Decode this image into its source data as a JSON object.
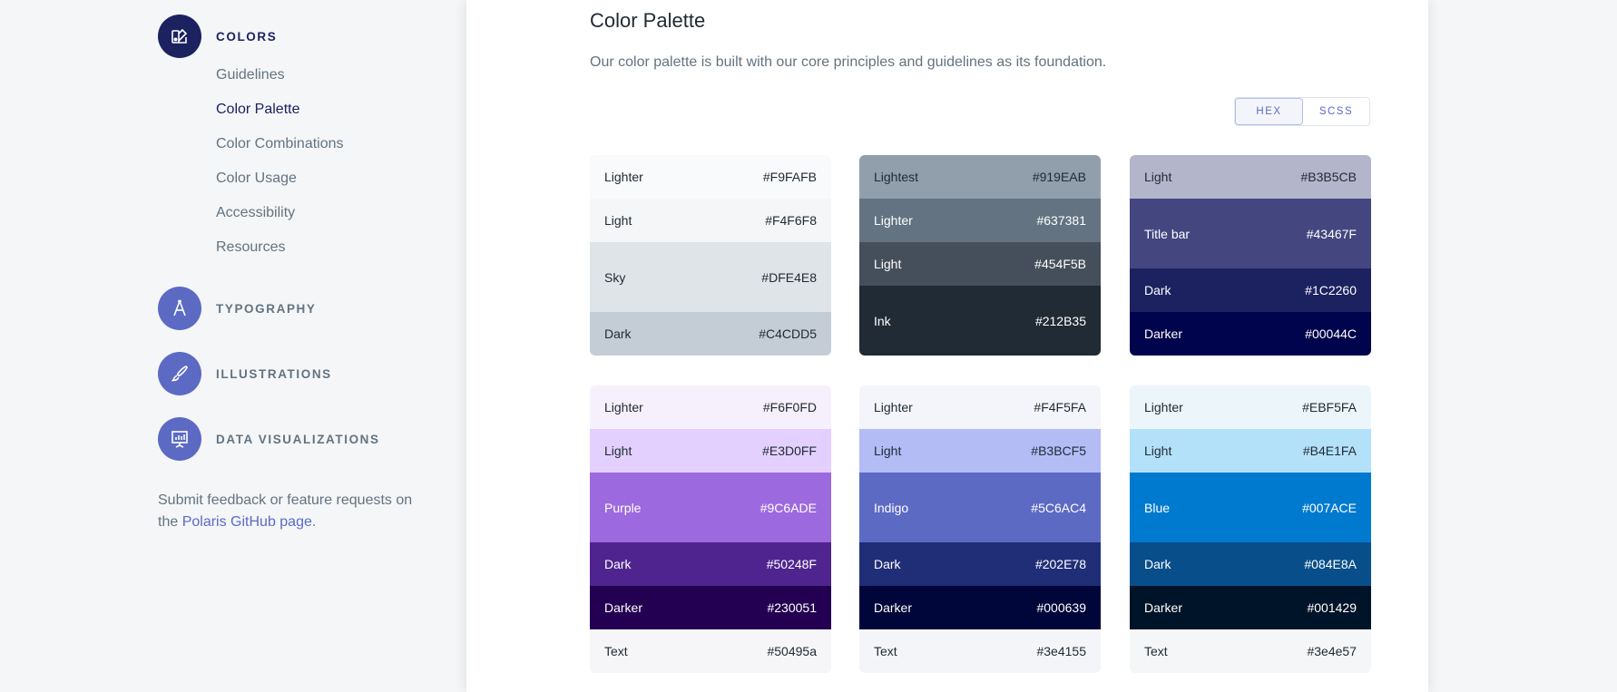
{
  "sidebar": {
    "sections": [
      {
        "name": "colors",
        "label": "COLORS",
        "icon": "color-swatch-icon",
        "active": true
      },
      {
        "name": "typography",
        "label": "TYPOGRAPHY",
        "icon": "typography-icon",
        "active": false
      },
      {
        "name": "illustrations",
        "label": "ILLUSTRATIONS",
        "icon": "brush-icon",
        "active": false
      },
      {
        "name": "data-visualizations",
        "label": "DATA VISUALIZATIONS",
        "icon": "presentation-chart-icon",
        "active": false
      }
    ],
    "subnav": [
      {
        "label": "Guidelines",
        "current": false
      },
      {
        "label": "Color Palette",
        "current": true
      },
      {
        "label": "Color Combinations",
        "current": false
      },
      {
        "label": "Color Usage",
        "current": false
      },
      {
        "label": "Accessibility",
        "current": false
      },
      {
        "label": "Resources",
        "current": false
      }
    ],
    "feedback": {
      "text_before": "Submit feedback or feature requests on the ",
      "link": "Polaris GitHub page",
      "text_after": "."
    }
  },
  "main": {
    "title": "Color Palette",
    "description": "Our color palette is built with our core principles and guidelines as its foundation.",
    "format_toggle": [
      {
        "label": "HEX",
        "selected": true
      },
      {
        "label": "SCSS",
        "selected": false
      }
    ],
    "palettes": [
      {
        "name": "sky",
        "swatches": [
          {
            "label": "Lighter",
            "hex": "#F9FAFB",
            "bg": "#F9FAFB",
            "fg": "#212b35",
            "size": 1
          },
          {
            "label": "Light",
            "hex": "#F4F6F8",
            "bg": "#F4F6F8",
            "fg": "#212b35",
            "size": 1
          },
          {
            "label": "Sky",
            "hex": "#DFE4E8",
            "bg": "#DFE4E8",
            "fg": "#212b35",
            "size": 1.6
          },
          {
            "label": "Dark",
            "hex": "#C4CDD5",
            "bg": "#C4CDD5",
            "fg": "#212b35",
            "size": 1
          }
        ]
      },
      {
        "name": "ink",
        "swatches": [
          {
            "label": "Lightest",
            "hex": "#919EAB",
            "bg": "#919EAB",
            "fg": "#212b35",
            "size": 1
          },
          {
            "label": "Lighter",
            "hex": "#637381",
            "bg": "#637381",
            "fg": "#ffffff",
            "size": 1
          },
          {
            "label": "Light",
            "hex": "#454F5B",
            "bg": "#454F5B",
            "fg": "#ffffff",
            "size": 1
          },
          {
            "label": "Ink",
            "hex": "#212B35",
            "bg": "#212B35",
            "fg": "#ffffff",
            "size": 1.6
          }
        ]
      },
      {
        "name": "blue-lighter",
        "swatches": [
          {
            "label": "Light",
            "hex": "#B3B5CB",
            "bg": "#B3B5CB",
            "fg": "#212b35",
            "size": 1
          },
          {
            "label": "Title bar",
            "hex": "#43467F",
            "bg": "#43467F",
            "fg": "#ffffff",
            "size": 1.6
          },
          {
            "label": "Dark",
            "hex": "#1C2260",
            "bg": "#1C2260",
            "fg": "#ffffff",
            "size": 1
          },
          {
            "label": "Darker",
            "hex": "#00044C",
            "bg": "#00044C",
            "fg": "#ffffff",
            "size": 1
          }
        ]
      },
      {
        "name": "purple",
        "swatches": [
          {
            "label": "Lighter",
            "hex": "#F6F0FD",
            "bg": "#F6F0FD",
            "fg": "#212b35",
            "size": 1
          },
          {
            "label": "Light",
            "hex": "#E3D0FF",
            "bg": "#E3D0FF",
            "fg": "#212b35",
            "size": 1
          },
          {
            "label": "Purple",
            "hex": "#9C6ADE",
            "bg": "#9C6ADE",
            "fg": "#ffffff",
            "size": 1.6
          },
          {
            "label": "Dark",
            "hex": "#50248F",
            "bg": "#50248F",
            "fg": "#ffffff",
            "size": 1
          },
          {
            "label": "Darker",
            "hex": "#230051",
            "bg": "#230051",
            "fg": "#ffffff",
            "size": 1
          },
          {
            "label": "Text",
            "hex": "#50495a",
            "bg": "#F6F6F8",
            "fg": "#212b35",
            "size": 1
          }
        ]
      },
      {
        "name": "indigo",
        "swatches": [
          {
            "label": "Lighter",
            "hex": "#F4F5FA",
            "bg": "#F4F5FA",
            "fg": "#212b35",
            "size": 1
          },
          {
            "label": "Light",
            "hex": "#B3BCF5",
            "bg": "#B3BCF5",
            "fg": "#212b35",
            "size": 1
          },
          {
            "label": "Indigo",
            "hex": "#5C6AC4",
            "bg": "#5C6AC4",
            "fg": "#ffffff",
            "size": 1.6
          },
          {
            "label": "Dark",
            "hex": "#202E78",
            "bg": "#202E78",
            "fg": "#ffffff",
            "size": 1
          },
          {
            "label": "Darker",
            "hex": "#000639",
            "bg": "#000639",
            "fg": "#ffffff",
            "size": 1
          },
          {
            "label": "Text",
            "hex": "#3e4155",
            "bg": "#F4F5F8",
            "fg": "#212b35",
            "size": 1
          }
        ]
      },
      {
        "name": "blue",
        "swatches": [
          {
            "label": "Lighter",
            "hex": "#EBF5FA",
            "bg": "#EBF5FA",
            "fg": "#212b35",
            "size": 1
          },
          {
            "label": "Light",
            "hex": "#B4E1FA",
            "bg": "#B4E1FA",
            "fg": "#212b35",
            "size": 1
          },
          {
            "label": "Blue",
            "hex": "#007ACE",
            "bg": "#007ACE",
            "fg": "#ffffff",
            "size": 1.6
          },
          {
            "label": "Dark",
            "hex": "#084E8A",
            "bg": "#084E8A",
            "fg": "#ffffff",
            "size": 1
          },
          {
            "label": "Darker",
            "hex": "#001429",
            "bg": "#001429",
            "fg": "#ffffff",
            "size": 1
          },
          {
            "label": "Text",
            "hex": "#3e4e57",
            "bg": "#F4F6F7",
            "fg": "#212b35",
            "size": 1
          }
        ]
      }
    ]
  }
}
